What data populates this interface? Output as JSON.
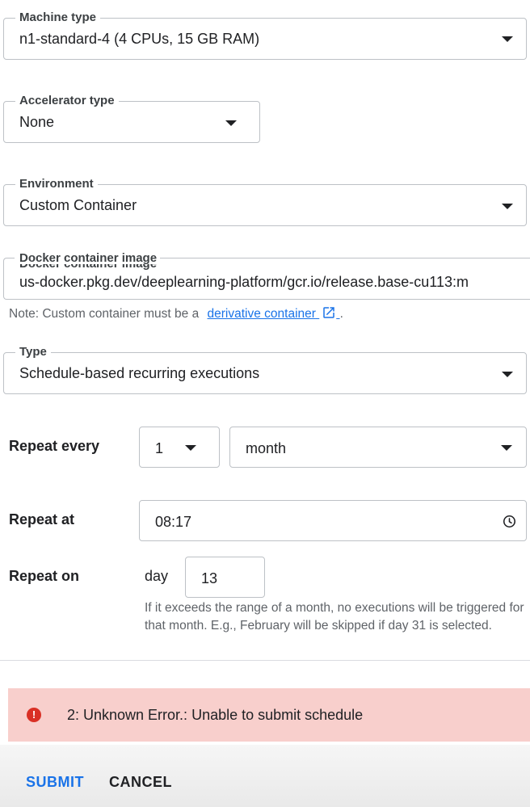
{
  "fields": {
    "machine_type": {
      "label": "Machine type",
      "value": "n1-standard-4 (4 CPUs, 15 GB RAM)"
    },
    "accelerator_type": {
      "label": "Accelerator type",
      "value": "None"
    },
    "environment": {
      "label": "Environment",
      "value": "Custom Container"
    },
    "docker_image": {
      "label": "Docker container image",
      "value": "us-docker.pkg.dev/deeplearning-platform/gcr.io/release.base-cu113:m"
    },
    "type": {
      "label": "Type",
      "value": "Schedule-based recurring executions"
    }
  },
  "note": {
    "prefix": "Note: Custom container must be a",
    "link": "derivative container",
    "suffix": "."
  },
  "repeat_every": {
    "label": "Repeat every",
    "count": "1",
    "unit": "month"
  },
  "repeat_at": {
    "label": "Repeat at",
    "time": "08:17"
  },
  "repeat_on": {
    "label": "Repeat on",
    "day_label": "day",
    "day_value": "13",
    "helper": "If it exceeds the range of a month, no executions will be triggered for that month. E.g., February will be skipped if day 31 is selected."
  },
  "error": {
    "icon": "!",
    "message": "2: Unknown Error.: Unable to submit schedule"
  },
  "actions": {
    "submit": "SUBMIT",
    "cancel": "CANCEL"
  },
  "colors": {
    "link": "#1a73e8",
    "error_bg": "#f8cfcc",
    "error_icon": "#d93025"
  },
  "icons": [
    "dropdown-arrow-icon",
    "open-in-new-icon",
    "clock-icon",
    "error-icon"
  ]
}
